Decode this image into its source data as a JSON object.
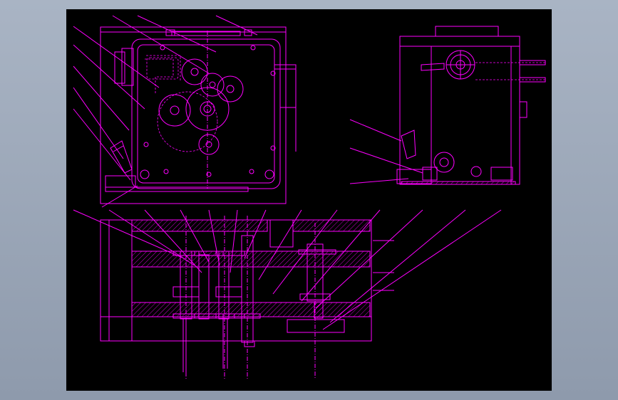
{
  "drawing": {
    "background": "#000000",
    "line_color": "#ff00ff",
    "accent_color": "#ffffff",
    "views": [
      "front-view",
      "side-view",
      "section-view"
    ]
  }
}
